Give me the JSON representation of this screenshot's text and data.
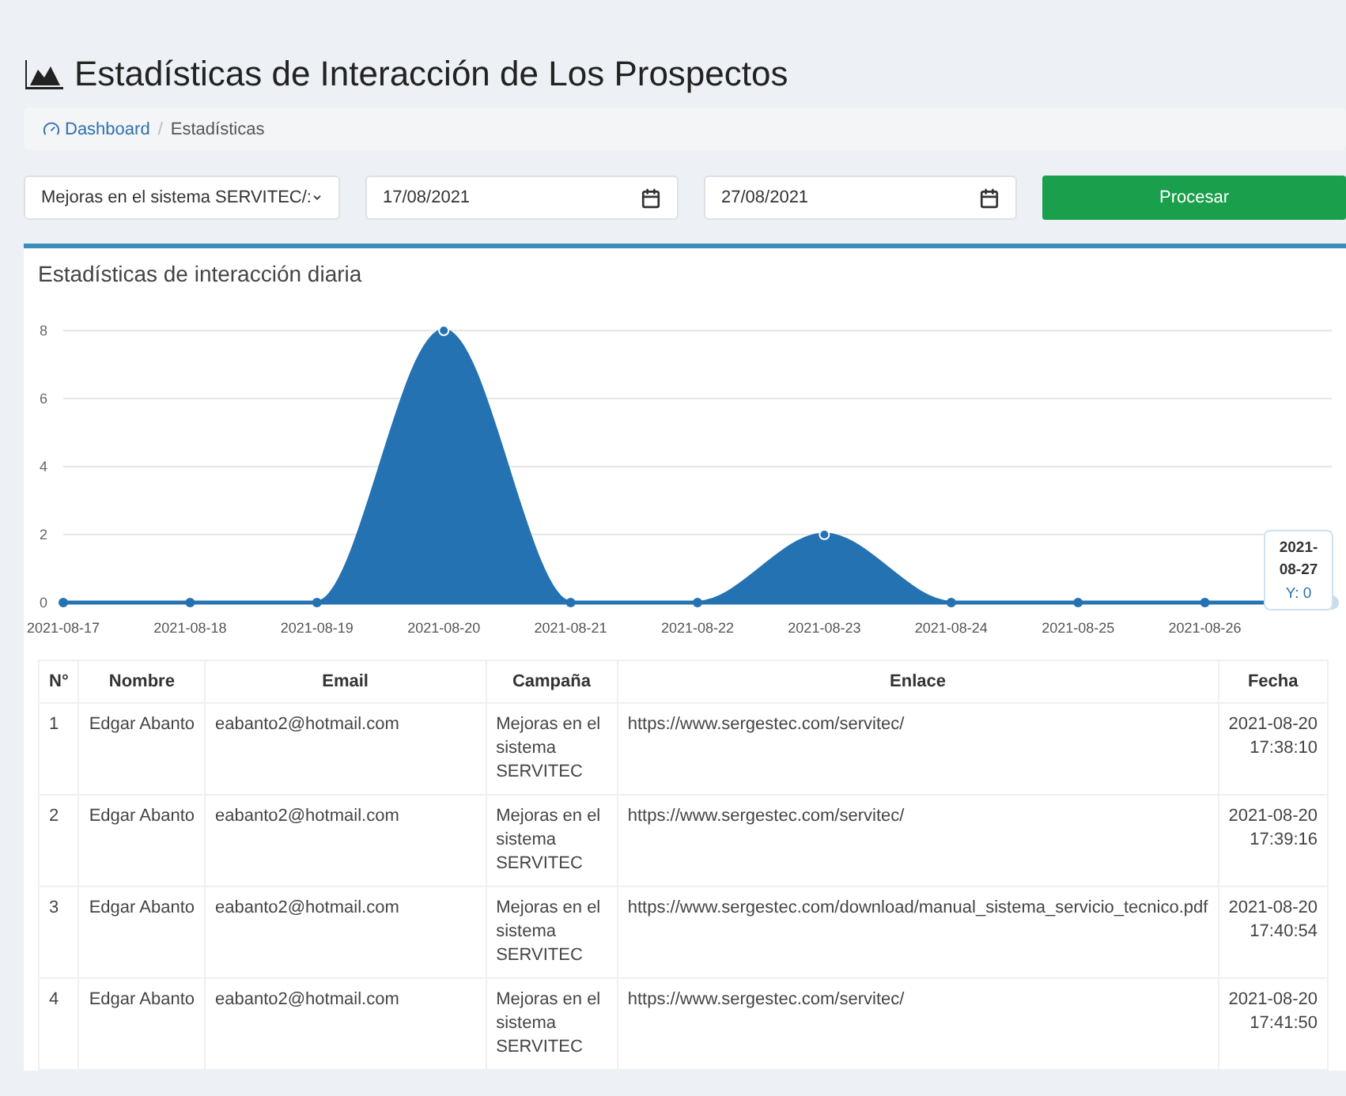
{
  "page_title": "Estadísticas de Interacción de Los Prospectos",
  "breadcrumb": [
    {
      "label": "Dashboard",
      "kind": "link"
    },
    {
      "label": "Estadísticas",
      "kind": "current"
    }
  ],
  "breadcrumb_separator": "/",
  "filters": {
    "campaign": "Mejoras en el sistema SERVITEC/:",
    "date_from": "17/08/2021",
    "date_to": "27/08/2021",
    "submit": "Procesar"
  },
  "chart_card": {
    "title": "Estadísticas de interacción diaria",
    "chart_data": {
      "type": "area",
      "categories": [
        "2021-08-17",
        "2021-08-18",
        "2021-08-19",
        "2021-08-20",
        "2021-08-21",
        "2021-08-22",
        "2021-08-23",
        "2021-08-24",
        "2021-08-25",
        "2021-08-26"
      ],
      "series": [
        {
          "color": "#2472b2",
          "values": [
            0,
            0,
            0,
            8,
            0,
            0,
            2,
            0,
            0,
            0
          ]
        }
      ],
      "ylim": [
        0,
        8
      ],
      "grid": true,
      "yticks": [
        0,
        2,
        4,
        6,
        8
      ]
    },
    "tooltip": {
      "title": "2021-08-27",
      "value": "Y: 0"
    }
  },
  "table": {
    "columns": [
      "N°",
      "Nombre",
      "Email",
      "Campaña",
      "Enlace",
      "Fecha"
    ],
    "rows": [
      {
        "n": "1",
        "name": "Edgar Abanto",
        "email": "eabanto2@hotmail.com",
        "campaign": "Mejoras en el sistema SERVITEC",
        "link": "https://www.sergestec.com/servitec/",
        "date": "2021-08-20",
        "time": "17:38:10"
      },
      {
        "n": "2",
        "name": "Edgar Abanto",
        "email": "eabanto2@hotmail.com",
        "campaign": "Mejoras en el sistema SERVITEC",
        "link": "https://www.sergestec.com/servitec/",
        "date": "2021-08-20",
        "time": "17:39:16"
      },
      {
        "n": "3",
        "name": "Edgar Abanto",
        "email": "eabanto2@hotmail.com",
        "campaign": "Mejoras en el sistema SERVITEC",
        "link": "https://www.sergestec.com/download/manual_sistema_servicio_tecnico.pdf",
        "date": "2021-08-20",
        "time": "17:40:54"
      },
      {
        "n": "4",
        "name": "Edgar Abanto",
        "email": "eabanto2@hotmail.com",
        "campaign": "Mejoras en el sistema SERVITEC",
        "link": "https://www.sergestec.com/servitec/",
        "date": "2021-08-20",
        "time": "17:41:50"
      }
    ]
  }
}
